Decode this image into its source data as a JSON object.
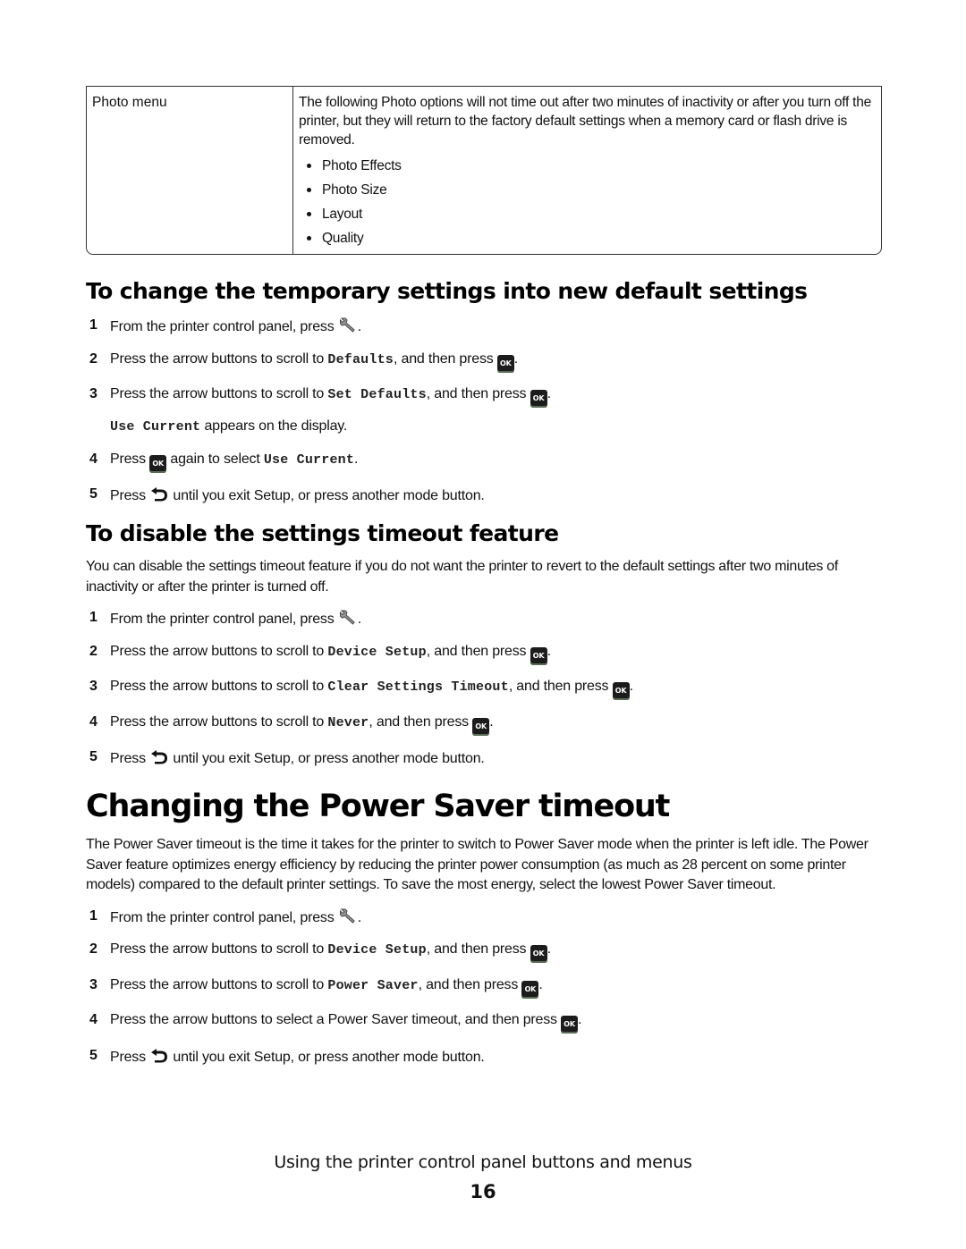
{
  "table": {
    "row": {
      "name": "Photo menu",
      "description": "The following Photo options will not time out after two minutes of inactivity or after you turn off the printer, but they will return to the factory default settings when a memory card or flash drive is removed.",
      "bullets": [
        "Photo Effects",
        "Photo Size",
        "Layout",
        "Quality"
      ]
    }
  },
  "section1": {
    "heading": "To change the temporary settings into new default settings",
    "steps": [
      {
        "num": "1",
        "pre": "From the printer control panel, press ",
        "icon": "wrench-icon",
        "post": "."
      },
      {
        "num": "2",
        "pre": "Press the arrow buttons to scroll to ",
        "code": "Defaults",
        "mid": ", and then press ",
        "icon": "ok-icon",
        "post": "."
      },
      {
        "num": "3",
        "pre": "Press the arrow buttons to scroll to ",
        "code": "Set Defaults",
        "mid": ", and then press ",
        "icon": "ok-icon",
        "post": ".",
        "sub_code": "Use Current",
        "sub_text": " appears on the display."
      },
      {
        "num": "4",
        "pre": "Press ",
        "icon": "ok-icon",
        "mid": " again to select ",
        "code": "Use Current",
        "post": "."
      },
      {
        "num": "5",
        "pre": "Press ",
        "icon": "back-icon",
        "post": " until you exit Setup, or press another mode button."
      }
    ]
  },
  "section2": {
    "heading": "To disable the settings timeout feature",
    "intro": "You can disable the settings timeout feature if you do not want the printer to revert to the default settings after two minutes of inactivity or after the printer is turned off.",
    "steps": [
      {
        "num": "1",
        "pre": "From the printer control panel, press ",
        "post": "."
      },
      {
        "num": "2",
        "pre": "Press the arrow buttons to scroll to ",
        "code": "Device Setup",
        "mid": ", and then press ",
        "post": "."
      },
      {
        "num": "3",
        "pre": "Press the arrow buttons to scroll to ",
        "code": "Clear Settings Timeout",
        "mid": ", and then press ",
        "post": "."
      },
      {
        "num": "4",
        "pre": "Press the arrow buttons to scroll to ",
        "code": "Never",
        "mid": ", and then press ",
        "post": "."
      },
      {
        "num": "5",
        "pre": "Press ",
        "post": " until you exit Setup, or press another mode button."
      }
    ]
  },
  "section3": {
    "heading": "Changing the Power Saver timeout",
    "intro": "The Power Saver timeout is the time it takes for the printer to switch to Power Saver mode when the printer is left idle. The Power Saver feature optimizes energy efficiency by reducing the printer power consumption (as much as 28 percent on some printer models) compared to the default printer settings. To save the most energy, select the lowest Power Saver timeout.",
    "steps": [
      {
        "num": "1",
        "pre": "From the printer control panel, press ",
        "post": "."
      },
      {
        "num": "2",
        "pre": "Press the arrow buttons to scroll to ",
        "code": "Device Setup",
        "mid": ", and then press ",
        "post": "."
      },
      {
        "num": "3",
        "pre": "Press the arrow buttons to scroll to ",
        "code": "Power Saver",
        "mid": ", and then press ",
        "post": "."
      },
      {
        "num": "4",
        "pre": "Press the arrow buttons to select a Power Saver timeout, and then press ",
        "post": "."
      },
      {
        "num": "5",
        "pre": "Press ",
        "post": " until you exit Setup, or press another mode button."
      }
    ]
  },
  "icons": {
    "ok_label": "OK"
  },
  "footer": {
    "title": "Using the printer control panel buttons and menus",
    "page_number": "16"
  }
}
